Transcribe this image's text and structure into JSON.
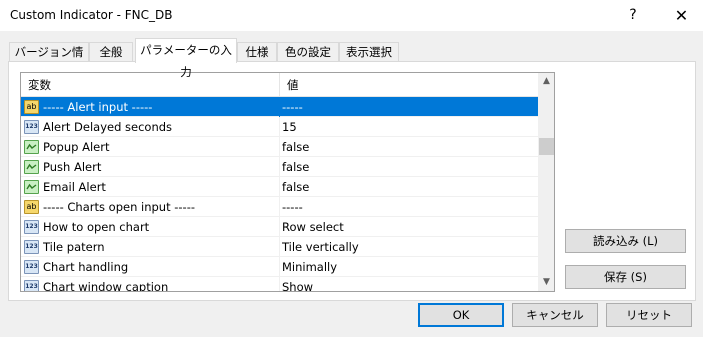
{
  "window": {
    "title": "Custom Indicator - FNC_DB",
    "help_glyph": "?",
    "close_glyph": "✕"
  },
  "tabs": [
    {
      "label": "バージョン情報"
    },
    {
      "label": "全般"
    },
    {
      "label": "パラメーターの入力"
    },
    {
      "label": "仕様"
    },
    {
      "label": "色の設定"
    },
    {
      "label": "表示選択"
    }
  ],
  "grid": {
    "headers": {
      "name": "変数",
      "value": "値"
    },
    "rows": [
      {
        "type": "ab",
        "name": "----- Alert input -----",
        "value": "-----",
        "selected": true
      },
      {
        "type": "123",
        "name": "Alert Delayed seconds",
        "value": "15"
      },
      {
        "type": "bool",
        "name": "Popup Alert",
        "value": "false"
      },
      {
        "type": "bool",
        "name": "Push Alert",
        "value": "false"
      },
      {
        "type": "bool",
        "name": "Email Alert",
        "value": "false"
      },
      {
        "type": "ab",
        "name": "----- Charts open input -----",
        "value": "-----"
      },
      {
        "type": "123",
        "name": "How to open chart",
        "value": "Row select"
      },
      {
        "type": "123",
        "name": "Tile patern",
        "value": "Tile vertically"
      },
      {
        "type": "123",
        "name": "Chart handling",
        "value": "Minimally"
      },
      {
        "type": "123",
        "name": "Chart window caption",
        "value": "Show"
      }
    ]
  },
  "icon_text": {
    "ab": "ab",
    "num": "123"
  },
  "scroll": {
    "up_glyph": "▲",
    "down_glyph": "▼"
  },
  "buttons": {
    "load": "読み込み (L)",
    "save": "保存 (S)",
    "ok": "OK",
    "cancel": "キャンセル",
    "reset": "リセット"
  },
  "colors": {
    "selection": "#0078d7",
    "default_button_border": "#0078d7"
  }
}
